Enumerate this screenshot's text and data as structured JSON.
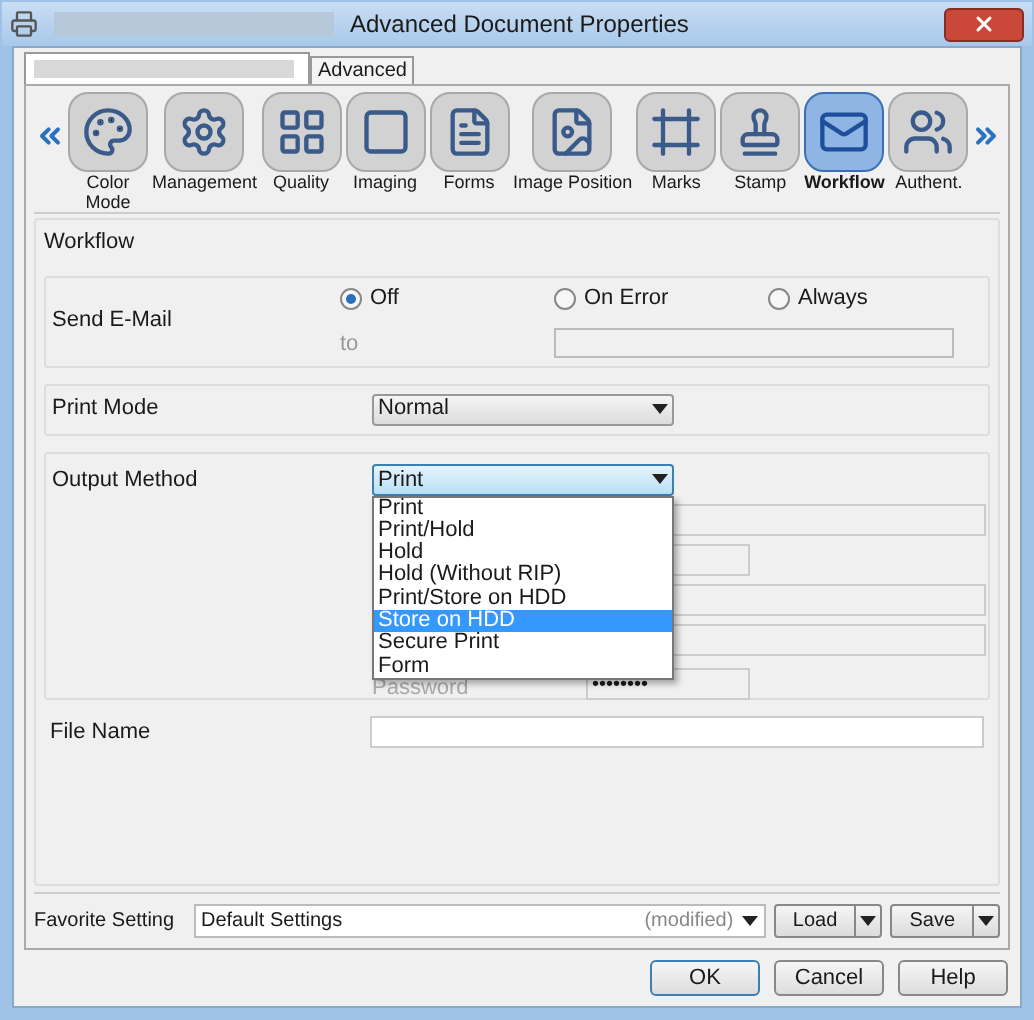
{
  "window": {
    "title": "Advanced Document Properties"
  },
  "tabs": [
    {
      "label": "Advanced"
    }
  ],
  "categories": [
    {
      "label": "Color Mode",
      "selected": false
    },
    {
      "label": "Management",
      "selected": false
    },
    {
      "label": "Quality",
      "selected": false
    },
    {
      "label": "Imaging",
      "selected": false
    },
    {
      "label": "Forms",
      "selected": false
    },
    {
      "label": "Image Position",
      "selected": false
    },
    {
      "label": "Marks",
      "selected": false
    },
    {
      "label": "Stamp",
      "selected": false
    },
    {
      "label": "Workflow",
      "selected": true
    },
    {
      "label": "Authent.",
      "selected": false
    }
  ],
  "section_title": "Workflow",
  "send_email": {
    "label": "Send E-Mail",
    "options": [
      {
        "label": "Off",
        "selected": true
      },
      {
        "label": "On Error",
        "selected": false
      },
      {
        "label": "Always",
        "selected": false
      }
    ],
    "to_label": "to"
  },
  "print_mode": {
    "label": "Print Mode",
    "value": "Normal"
  },
  "output_method": {
    "label": "Output Method",
    "value": "Print",
    "options": [
      {
        "label": "Print",
        "highlighted": false
      },
      {
        "label": "Print/Hold",
        "highlighted": false
      },
      {
        "label": "Hold",
        "highlighted": false
      },
      {
        "label": "Hold (Without RIP)",
        "highlighted": false
      },
      {
        "label": "Print/Store on HDD",
        "highlighted": false
      },
      {
        "label": "Store on HDD",
        "highlighted": true
      },
      {
        "label": "Secure Print",
        "highlighted": false
      },
      {
        "label": "Form",
        "highlighted": false
      }
    ],
    "password_label": "Password",
    "password_value": "••••••••"
  },
  "file_name": {
    "label": "File Name"
  },
  "favorite": {
    "label": "Favorite Setting",
    "value": "Default Settings",
    "status": "(modified)",
    "buttons": [
      "Load",
      "Save"
    ]
  },
  "footer_buttons": [
    "OK",
    "Cancel",
    "Help"
  ]
}
